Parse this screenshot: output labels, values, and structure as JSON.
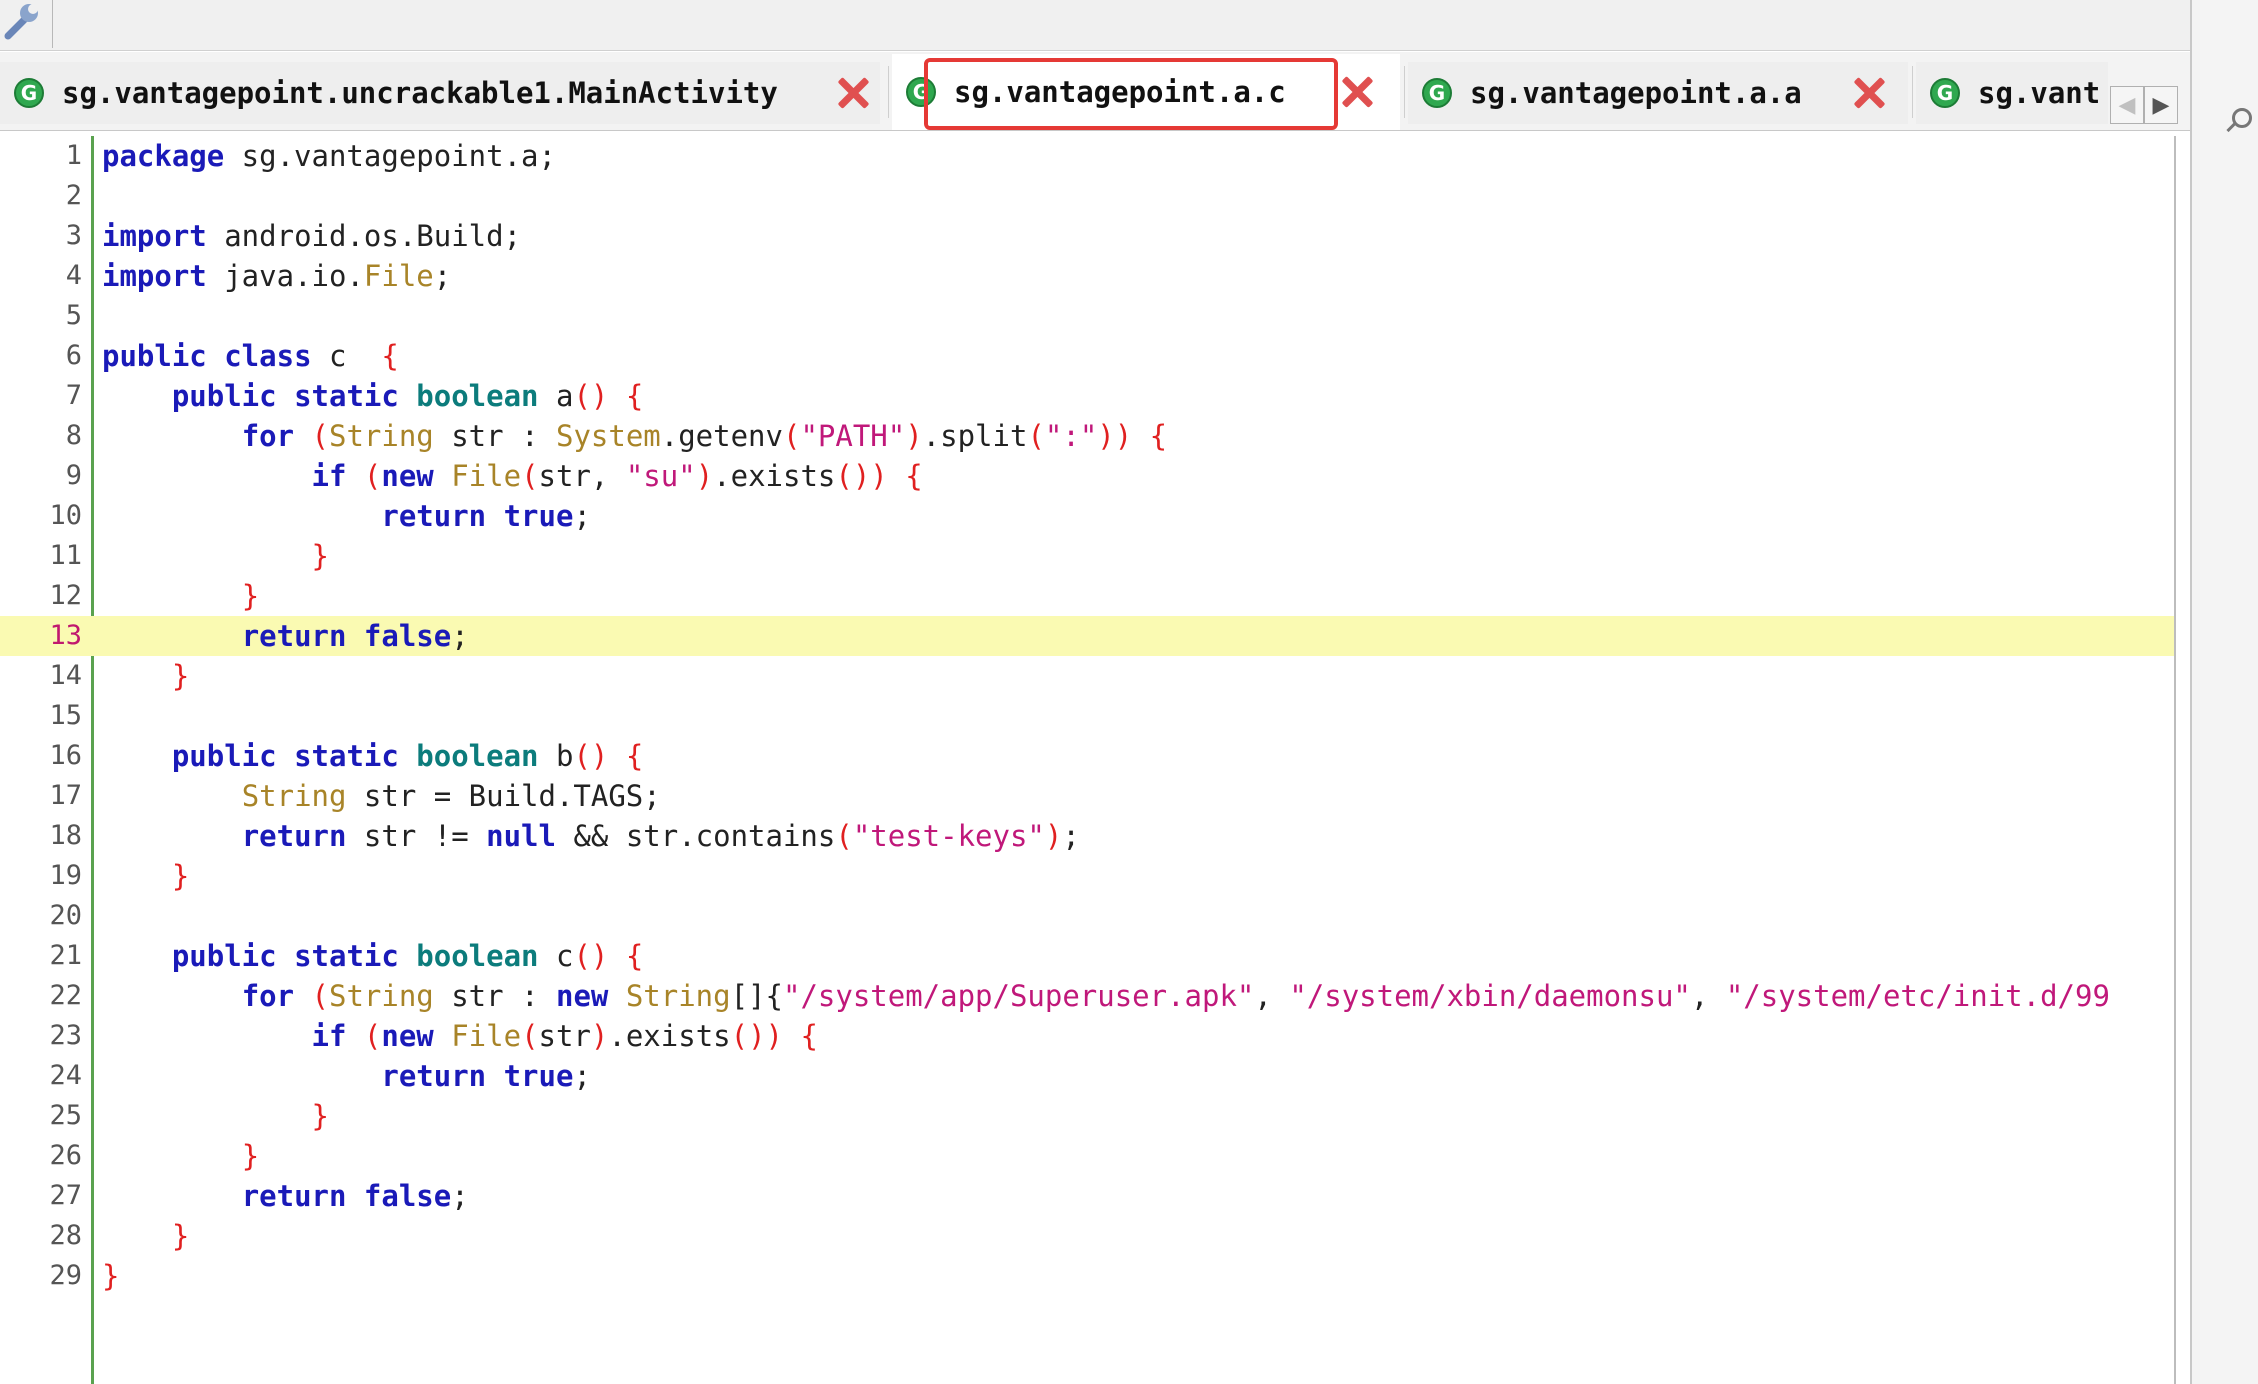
{
  "toolbar": {
    "tool_icon": "wrench-icon"
  },
  "tabs": [
    {
      "label": "sg.vantagepoint.uncrackable1.MainActivity",
      "icon": "class-g-icon",
      "active": false
    },
    {
      "label": "sg.vantagepoint.a.c",
      "icon": "class-g-icon",
      "active": true
    },
    {
      "label": "sg.vantagepoint.a.a",
      "icon": "class-g-icon",
      "active": false
    },
    {
      "label": "sg.vant",
      "icon": "class-g-icon",
      "active": false
    }
  ],
  "tab_glyph": "G",
  "tab_nav": {
    "prev": "◀",
    "next": "▶"
  },
  "current_line": 13,
  "colors": {
    "keyword": "#1a1ab8",
    "type": "#0c7c7c",
    "class": "#a88428",
    "string": "#c0187a",
    "brace": "#e02020",
    "current_line_bg": "#fafab2",
    "highlight_box": "#e53935"
  },
  "code_lines": [
    [
      [
        "kw",
        "package"
      ],
      [
        "",
        "sg.vantagepoint.a;"
      ]
    ],
    [],
    [
      [
        "kw",
        "import"
      ],
      [
        "",
        "android.os.Build;"
      ]
    ],
    [
      [
        "kw",
        "import"
      ],
      [
        "",
        "java.io."
      ],
      [
        "cls",
        "File"
      ],
      [
        "",
        ";"
      ]
    ],
    [],
    [
      [
        "kw",
        "public"
      ],
      [
        "kw",
        "class"
      ],
      [
        "",
        " c "
      ],
      [
        "br",
        "{"
      ]
    ],
    [
      [
        "",
        "    "
      ],
      [
        "kw",
        "public"
      ],
      [
        "kw",
        "static"
      ],
      [
        "ty",
        "boolean"
      ],
      [
        "",
        " a"
      ],
      [
        "br",
        "()"
      ],
      [
        "",
        ""
      ],
      [
        "br",
        "{"
      ]
    ],
    [
      [
        "",
        "        "
      ],
      [
        "kw",
        "for"
      ],
      [
        "br",
        "("
      ],
      [
        "cls",
        "String"
      ],
      [
        "",
        " str : "
      ],
      [
        "cls",
        "System"
      ],
      [
        "",
        ".getenv"
      ],
      [
        "br",
        "("
      ],
      [
        "st",
        "\"PATH\""
      ],
      [
        "br",
        ")"
      ],
      [
        "",
        ".split"
      ],
      [
        "br",
        "("
      ],
      [
        "st",
        "\":\""
      ],
      [
        "br",
        "))"
      ],
      [
        "",
        ""
      ],
      [
        "br",
        "{"
      ]
    ],
    [
      [
        "",
        "            "
      ],
      [
        "kw",
        "if"
      ],
      [
        "br",
        "("
      ],
      [
        "kw",
        "new"
      ],
      [
        "cls",
        "File"
      ],
      [
        "br",
        "("
      ],
      [
        "",
        "str, "
      ],
      [
        "st",
        "\"su\""
      ],
      [
        "br",
        ")"
      ],
      [
        "",
        ".exists"
      ],
      [
        "br",
        "())"
      ],
      [
        "",
        ""
      ],
      [
        "br",
        "{"
      ]
    ],
    [
      [
        "",
        "                "
      ],
      [
        "kw",
        "return"
      ],
      [
        "kw",
        "true"
      ],
      [
        "",
        ";"
      ]
    ],
    [
      [
        "",
        "            "
      ],
      [
        "br",
        "}"
      ]
    ],
    [
      [
        "",
        "        "
      ],
      [
        "br",
        "}"
      ]
    ],
    [
      [
        "",
        "        "
      ],
      [
        "kw",
        "return"
      ],
      [
        "kw",
        "false"
      ],
      [
        "",
        ";"
      ]
    ],
    [
      [
        "",
        "    "
      ],
      [
        "br",
        "}"
      ]
    ],
    [],
    [
      [
        "",
        "    "
      ],
      [
        "kw",
        "public"
      ],
      [
        "kw",
        "static"
      ],
      [
        "ty",
        "boolean"
      ],
      [
        "",
        " b"
      ],
      [
        "br",
        "()"
      ],
      [
        "",
        ""
      ],
      [
        "br",
        "{"
      ]
    ],
    [
      [
        "",
        "        "
      ],
      [
        "cls",
        "String"
      ],
      [
        "",
        " str = Build.TAGS;"
      ]
    ],
    [
      [
        "",
        "        "
      ],
      [
        "kw",
        "return"
      ],
      [
        "",
        " str != "
      ],
      [
        "kw",
        "null"
      ],
      [
        "",
        " && str.contains"
      ],
      [
        "br",
        "("
      ],
      [
        "st",
        "\"test-keys\""
      ],
      [
        "br",
        ")"
      ],
      [
        "",
        ";"
      ]
    ],
    [
      [
        "",
        "    "
      ],
      [
        "br",
        "}"
      ]
    ],
    [],
    [
      [
        "",
        "    "
      ],
      [
        "kw",
        "public"
      ],
      [
        "kw",
        "static"
      ],
      [
        "ty",
        "boolean"
      ],
      [
        "",
        " c"
      ],
      [
        "br",
        "()"
      ],
      [
        "",
        ""
      ],
      [
        "br",
        "{"
      ]
    ],
    [
      [
        "",
        "        "
      ],
      [
        "kw",
        "for"
      ],
      [
        "br",
        "("
      ],
      [
        "cls",
        "String"
      ],
      [
        "",
        " str : "
      ],
      [
        "kw",
        "new"
      ],
      [
        "cls",
        "String"
      ],
      [
        "",
        "[]{"
      ],
      [
        "st",
        "\"/system/app/Superuser.apk\""
      ],
      [
        "",
        ", "
      ],
      [
        "st",
        "\"/system/xbin/daemonsu\""
      ],
      [
        "",
        ", "
      ],
      [
        "st",
        "\"/system/etc/init.d/99"
      ]
    ],
    [
      [
        "",
        "            "
      ],
      [
        "kw",
        "if"
      ],
      [
        "br",
        "("
      ],
      [
        "kw",
        "new"
      ],
      [
        "cls",
        "File"
      ],
      [
        "br",
        "("
      ],
      [
        "",
        "str"
      ],
      [
        "br",
        ")"
      ],
      [
        "",
        ".exists"
      ],
      [
        "br",
        "())"
      ],
      [
        "",
        ""
      ],
      [
        "br",
        "{"
      ]
    ],
    [
      [
        "",
        "                "
      ],
      [
        "kw",
        "return"
      ],
      [
        "kw",
        "true"
      ],
      [
        "",
        ";"
      ]
    ],
    [
      [
        "",
        "            "
      ],
      [
        "br",
        "}"
      ]
    ],
    [
      [
        "",
        "        "
      ],
      [
        "br",
        "}"
      ]
    ],
    [
      [
        "",
        "        "
      ],
      [
        "kw",
        "return"
      ],
      [
        "kw",
        "false"
      ],
      [
        "",
        ";"
      ]
    ],
    [
      [
        "",
        "    "
      ],
      [
        "br",
        "}"
      ]
    ],
    [
      [
        "br",
        "}"
      ]
    ]
  ]
}
